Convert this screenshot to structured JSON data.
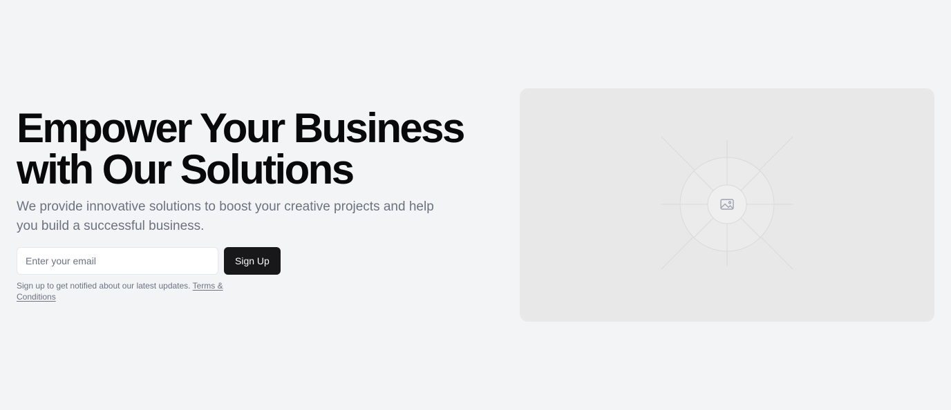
{
  "hero": {
    "headline_line1": "Empower Your Business",
    "headline_line2": "with Our Solutions",
    "subtitle": "We provide innovative solutions to boost your creative projects and help you build a successful business."
  },
  "form": {
    "email_placeholder": "Enter your email",
    "email_value": "",
    "signup_label": "Sign Up"
  },
  "note": {
    "text": "Sign up to get notified about our latest updates. ",
    "terms_link": "Terms & Conditions"
  },
  "image": {
    "icon": "image-placeholder-icon"
  },
  "colors": {
    "background": "#f3f4f6",
    "headline": "#09090b",
    "muted_text": "#6b7280",
    "button_bg": "#18181b",
    "button_text": "#fafafa",
    "image_bg": "#e8e8e8"
  }
}
